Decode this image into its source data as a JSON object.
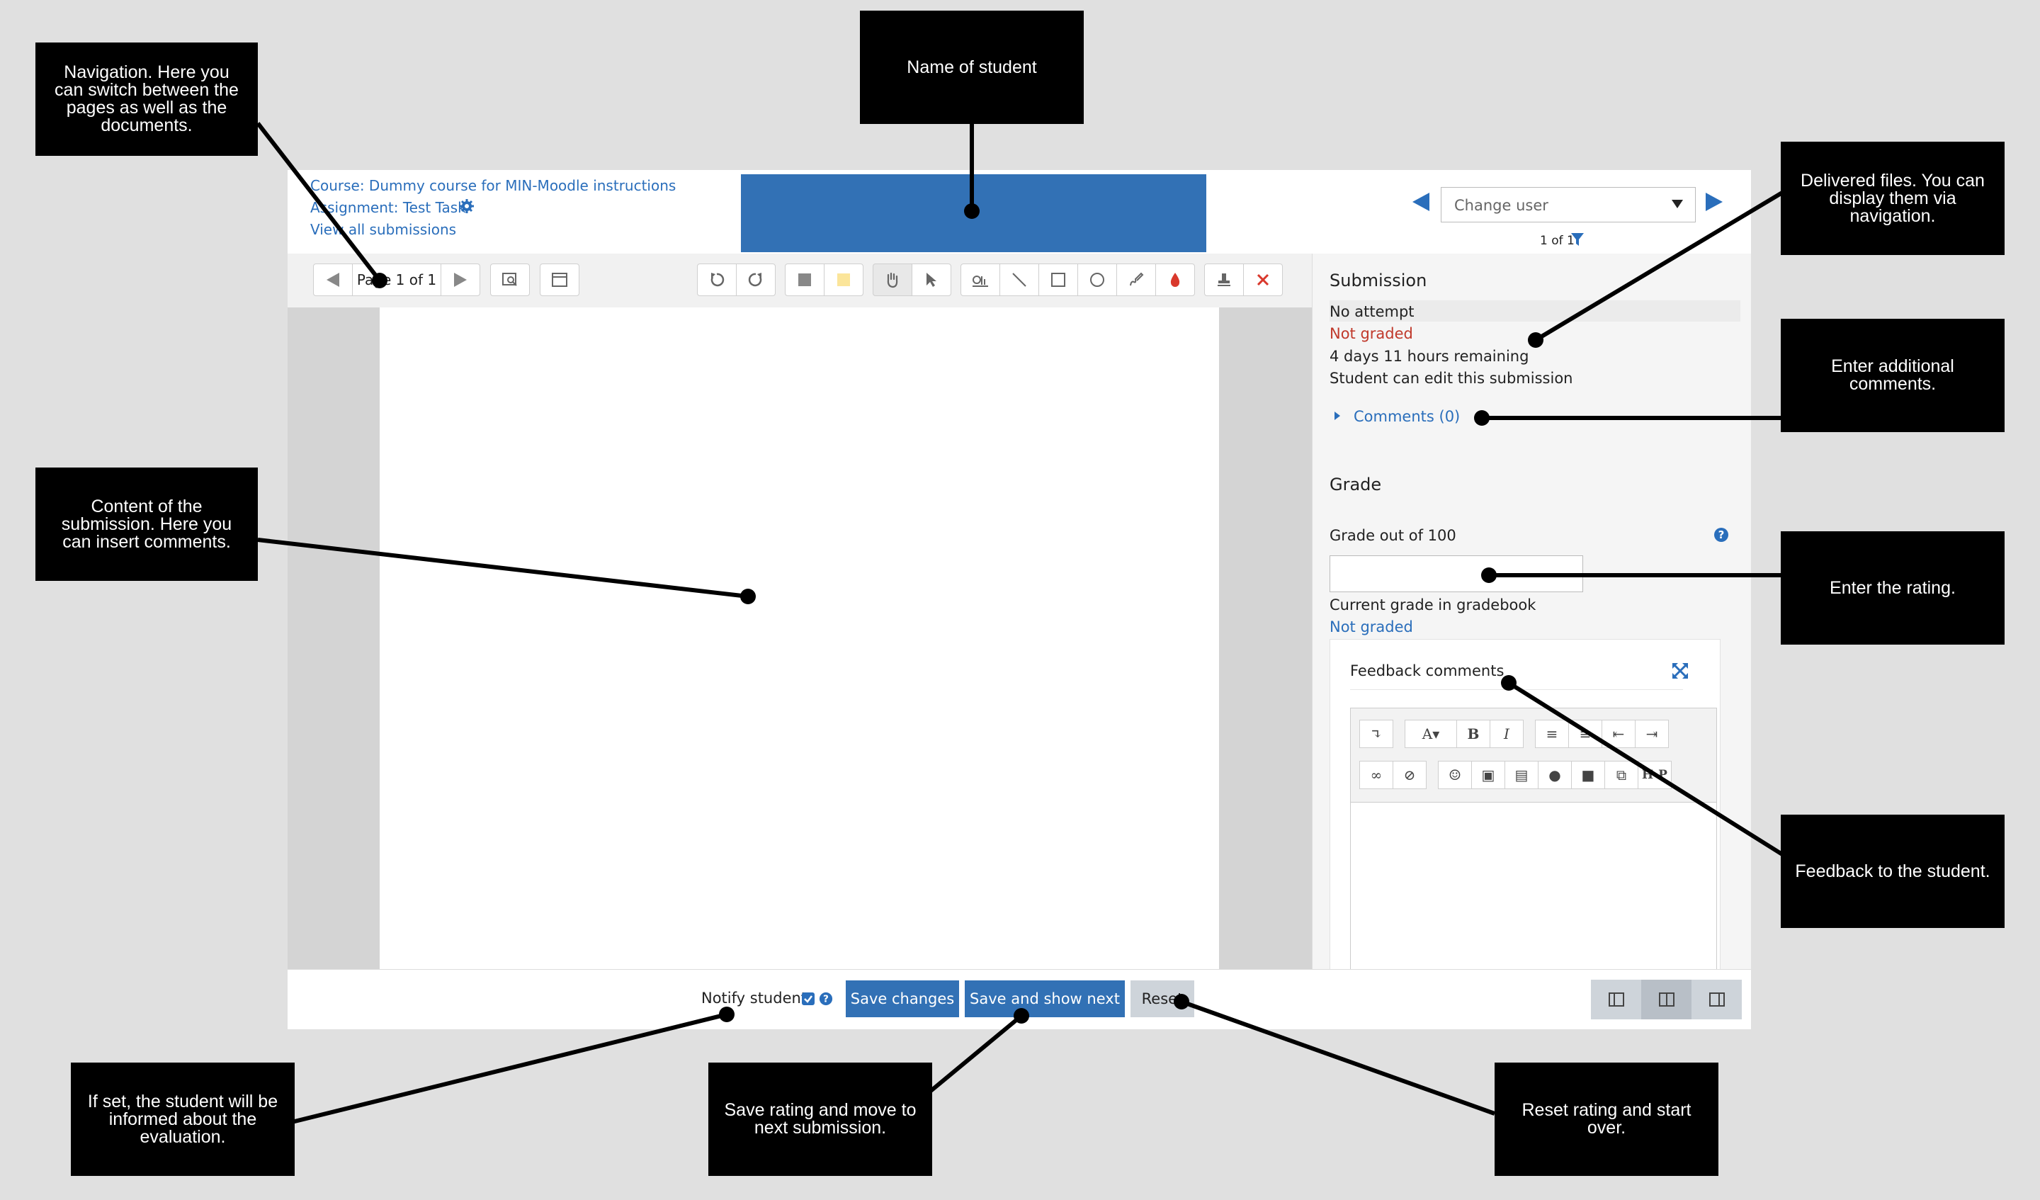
{
  "notes": {
    "navigation": "Navigation. Here you can switch between the pages as well as the documents.",
    "student_name": "Name of student",
    "delivered_files": "Delivered files. You can display them via navigation.",
    "comments": "Enter additional comments.",
    "content": "Content of the submission. Here you can insert comments.",
    "rating": "Enter the rating.",
    "feedback": "Feedback to the student.",
    "notify": "If set, the student will be informed about the evaluation.",
    "save_next": "Save rating and move to next submission.",
    "reset": "Reset rating and start over."
  },
  "header": {
    "course": "Course: Dummy course for MIN-Moodle instructions",
    "assignment": "Assignment: Test Task",
    "view_all": "View all submissions",
    "change_user_placeholder": "Change user",
    "user_count": "1 of 1"
  },
  "toolbar": {
    "page_label": "Page 1 of 1"
  },
  "submission": {
    "heading": "Submission",
    "status": "No attempt",
    "grading_status": "Not graded",
    "time_remaining": "4 days 11 hours remaining",
    "edit_status": "Student can edit this submission",
    "comments_link": "Comments (0)"
  },
  "grade": {
    "heading": "Grade",
    "label": "Grade out of 100",
    "value": "",
    "current_label": "Current grade in gradebook",
    "current_value": "Not graded",
    "feedback_label": "Feedback comments"
  },
  "footer": {
    "notify_label": "Notify student",
    "notify_checked": true,
    "save_changes": "Save changes",
    "save_show_next": "Save and show next",
    "reset": "Reset"
  },
  "colors": {
    "primary": "#3271b5",
    "link": "#2a6ebb",
    "not_graded_red": "#c0392b",
    "annotation_bg": "#000000",
    "page_bg": "#e0e0e0"
  }
}
